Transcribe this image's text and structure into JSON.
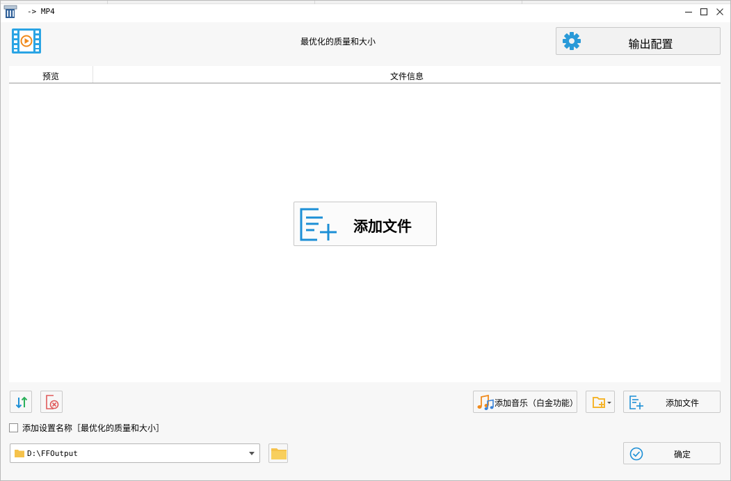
{
  "window": {
    "title": "-> MP4"
  },
  "header": {
    "preset_label": "最优化的质量和大小",
    "output_config_label": "输出配置"
  },
  "list": {
    "columns": [
      "预览",
      "文件信息"
    ],
    "add_file_big_label": "添加文件"
  },
  "toolbar": {
    "add_music_label": "添加音乐（白金功能）",
    "add_file_label": "添加文件",
    "confirm_label": "确定"
  },
  "options": {
    "add_preset_name_label": "添加设置名称［最优化的质量和大小］",
    "add_preset_name_checked": false
  },
  "output": {
    "path": "D:\\FFOutput"
  },
  "colors": {
    "accent_blue": "#1c8fd6",
    "folder_yellow": "#f5c24b",
    "remove_red": "#e05a5a"
  }
}
